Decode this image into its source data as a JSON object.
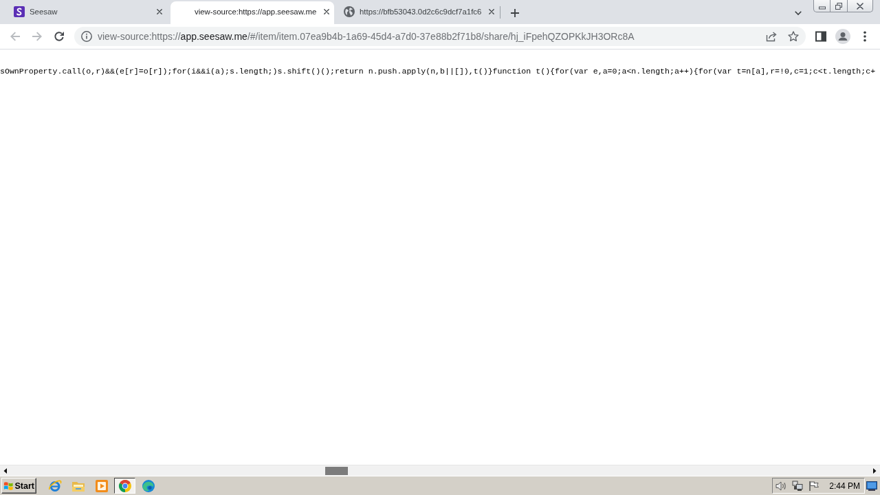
{
  "browser": {
    "tabs": [
      {
        "kind": "app",
        "title": "Seesaw",
        "selected": false
      },
      {
        "kind": "source",
        "title": "view-source:https://app.seesaw.me",
        "selected": true
      },
      {
        "kind": "web",
        "title": "https://bfb53043.0d2c6c9dcf7a1fc6",
        "selected": false
      }
    ],
    "nav_buttons": [
      {
        "kind": "back",
        "disabled": true
      },
      {
        "kind": "forward",
        "disabled": true
      },
      {
        "kind": "reload",
        "disabled": false
      }
    ],
    "address_bar": {
      "scheme": "view-source:https://",
      "host": "app.seesaw.me",
      "path": "/#/item/item.07ea9b4b-1a69-45d4-a7d0-37e88b2f71b8/share/hj_iFpehQZOPKkJH3ORc8A"
    }
  },
  "source_view": {
    "lines": [
      "sOwnProperty.call(o,r)&&(e[r]=o[r]);for(i&&i(a);s.length;)s.shift()();return n.push.apply(n,b||[]),t()}function t(){for(var e,a=0;a<n.length;a++){for(var t=n[a],r=!0,c=1;c<t.length;c+"
    ]
  },
  "taskbar": {
    "start_label": "Start",
    "apps": [
      {
        "kind": "orbit",
        "selected": false
      },
      {
        "kind": "folder",
        "selected": false
      },
      {
        "kind": "player",
        "selected": false
      },
      {
        "kind": "ring",
        "selected": true
      },
      {
        "kind": "swirl",
        "selected": false
      }
    ],
    "clock": "2:44 PM"
  }
}
